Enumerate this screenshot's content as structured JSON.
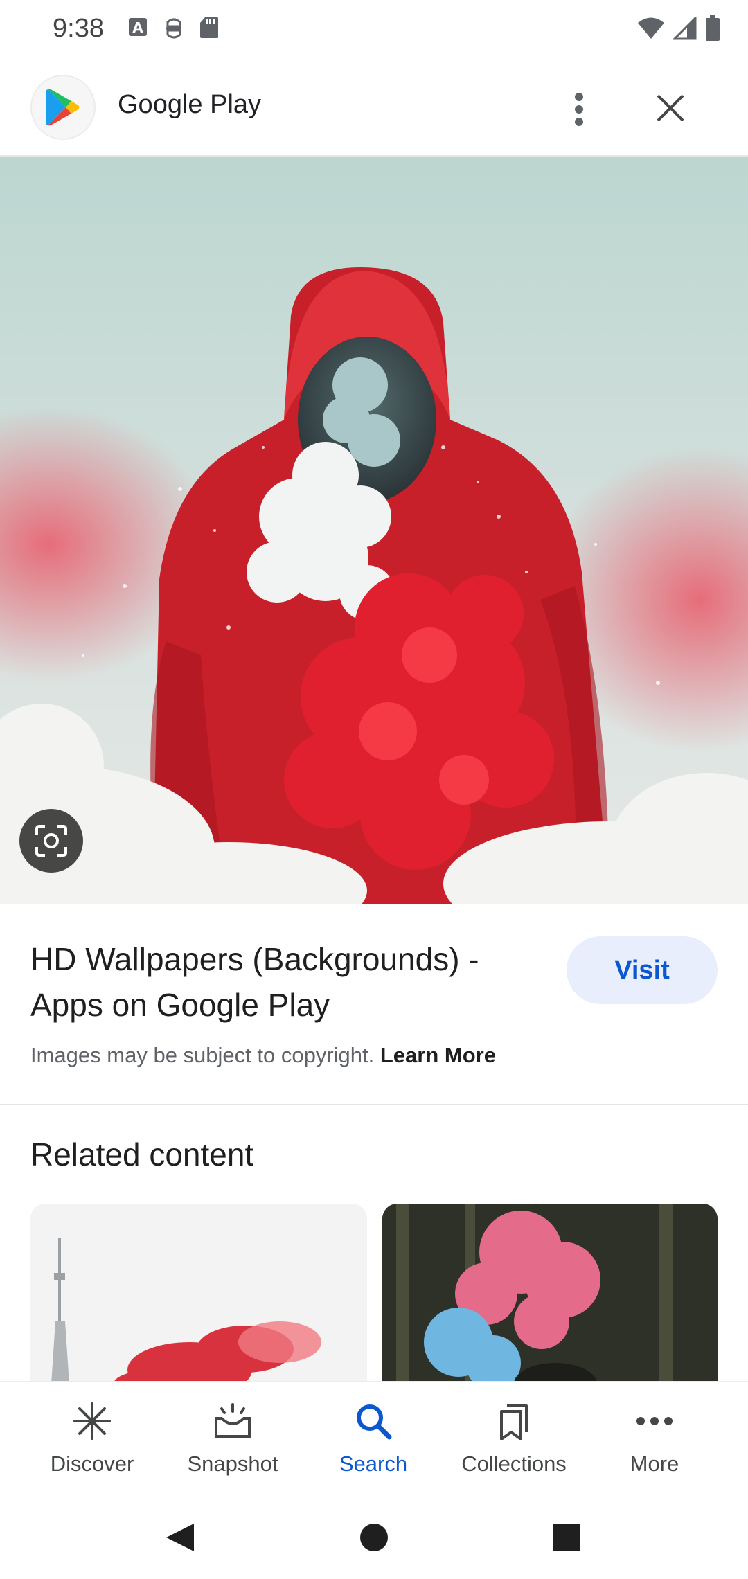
{
  "status_bar": {
    "time": "9:38",
    "left_icons": [
      "a-box-icon",
      "robot-icon",
      "sd-card-icon"
    ],
    "right_icons": [
      "wifi-icon",
      "signal-icon",
      "battery-icon"
    ]
  },
  "header": {
    "app_name": "Google Play",
    "logo_icon": "google-play-logo",
    "menu_icon": "more-vert-icon",
    "close_icon": "close-icon"
  },
  "hero_image": {
    "lens_icon": "lens-icon"
  },
  "result": {
    "title": "HD Wallpapers (Backgrounds) - Apps on Google Play",
    "visit_label": "Visit",
    "copyright_text": "Images may be subject to copyright.",
    "learn_more_label": "Learn More"
  },
  "related": {
    "heading": "Related content"
  },
  "bottom_nav": {
    "items": [
      {
        "label": "Discover",
        "icon": "asterisk-icon",
        "active": false
      },
      {
        "label": "Snapshot",
        "icon": "snapshot-icon",
        "active": false
      },
      {
        "label": "Search",
        "icon": "search-icon",
        "active": true
      },
      {
        "label": "Collections",
        "icon": "collections-icon",
        "active": false
      },
      {
        "label": "More",
        "icon": "more-horiz-icon",
        "active": false
      }
    ]
  },
  "system_nav": {
    "back_icon": "back-triangle-icon",
    "home_icon": "home-circle-icon",
    "recents_icon": "recents-square-icon"
  },
  "colors": {
    "accent": "#0b57d0",
    "visit_bg": "#e8eefb",
    "smoke_red": "#e0202e",
    "hoodie_red": "#d0212b"
  }
}
